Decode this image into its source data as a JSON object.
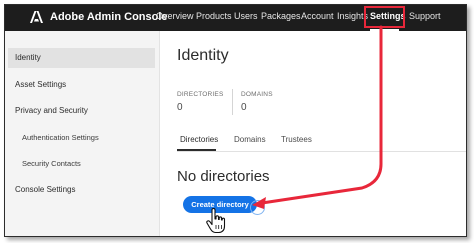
{
  "app": {
    "title": "Adobe Admin Console"
  },
  "nav": {
    "items": [
      "Overview",
      "Products",
      "Users",
      "Packages",
      "Account",
      "Insights",
      "Settings",
      "Support"
    ],
    "active": "Settings"
  },
  "sidebar": {
    "items": [
      {
        "label": "Identity"
      },
      {
        "label": "Asset Settings"
      },
      {
        "label": "Privacy and Security"
      },
      {
        "label": "Authentication Settings"
      },
      {
        "label": "Security Contacts"
      },
      {
        "label": "Console Settings"
      }
    ]
  },
  "main": {
    "title": "Identity",
    "stats": [
      {
        "label": "DIRECTORIES",
        "value": "0"
      },
      {
        "label": "DOMAINS",
        "value": "0"
      }
    ],
    "tabs": [
      "Directories",
      "Domains",
      "Trustees"
    ],
    "empty_title": "No directories",
    "create_button": "Create directory"
  },
  "colors": {
    "topbar": "#1d1d1d",
    "highlight": "#e8273a",
    "primary": "#1473e6"
  }
}
